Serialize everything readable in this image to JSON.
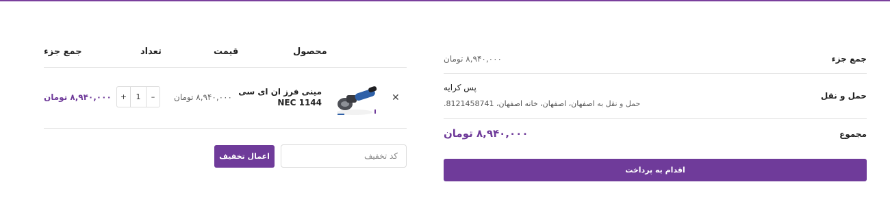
{
  "colors": {
    "accent": "#6f3b9a",
    "border": "#dcdcdc",
    "muted": "#666666"
  },
  "cart": {
    "headers": {
      "product": "محصول",
      "price": "قیمت",
      "quantity": "تعداد",
      "subtotal": "جمع جزء"
    },
    "items": [
      {
        "remove_icon": "close-icon",
        "name": "مینی فرز ان ای سی NEC 1144",
        "price": "۸,۹۴۰,۰۰۰ تومان",
        "quantity": "1",
        "qty_plus": "+",
        "qty_minus": "–",
        "subtotal": "۸,۹۴۰,۰۰۰ تومان"
      }
    ],
    "coupon": {
      "placeholder": "کد تخفیف",
      "button": "اعمال تخفیف"
    }
  },
  "totals": {
    "subtotal_label": "جمع جزء",
    "subtotal_value": "۸,۹۴۰,۰۰۰ تومان",
    "shipping_label": "حمل و نقل",
    "shipping_method": "پس کرایه",
    "shipping_destination_prefix": "حمل و نقل به",
    "shipping_destination": "اصفهان، اصفهان، خانه اصفهان، 8121458741.",
    "total_label": "مجموع",
    "total_value": "۸,۹۴۰,۰۰۰ تومان",
    "checkout_button": "اقدام به پرداخت"
  }
}
